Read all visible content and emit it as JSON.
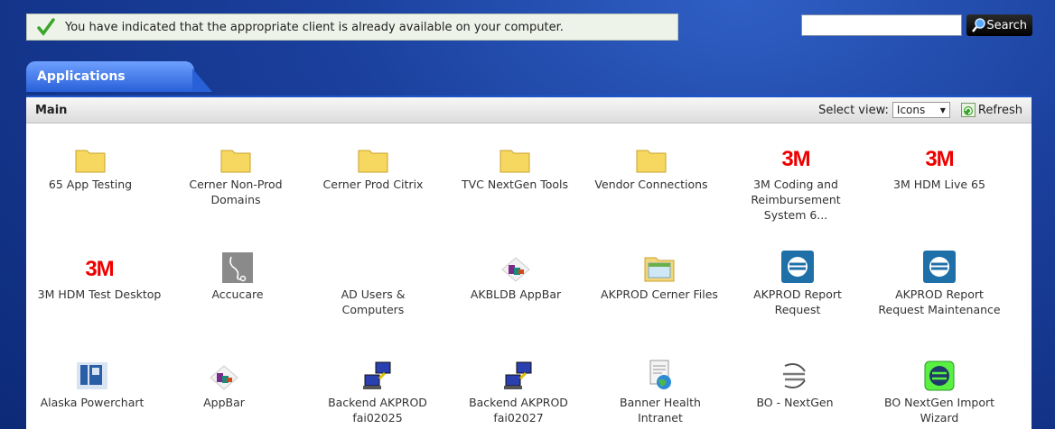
{
  "notice": {
    "text": "You have indicated that the appropriate client is already available on your computer."
  },
  "search": {
    "placeholder": "",
    "button_label": "Search"
  },
  "tabs": [
    {
      "label": "Applications"
    }
  ],
  "panel": {
    "title": "Main",
    "select_view_label": "Select view:",
    "select_view_value": "Icons",
    "refresh_label": "Refresh"
  },
  "apps": [
    {
      "label": "65 App Testing",
      "icon": "folder-icon"
    },
    {
      "label": "Cerner Non-Prod Domains",
      "icon": "folder-icon"
    },
    {
      "label": "Cerner Prod Citrix",
      "icon": "folder-icon"
    },
    {
      "label": "TVC NextGen Tools",
      "icon": "folder-icon"
    },
    {
      "label": "Vendor Connections",
      "icon": "folder-icon"
    },
    {
      "label": "3M Coding and Reimbursement System 6...",
      "icon": "3m-logo"
    },
    {
      "label": "3M HDM Live 65",
      "icon": "3m-logo"
    },
    {
      "label": "3M HDM Test Desktop",
      "icon": "3m-logo"
    },
    {
      "label": "Accucare",
      "icon": "stethoscope-icon"
    },
    {
      "label": "AD Users & Computers",
      "icon": "none"
    },
    {
      "label": "AKBLDB AppBar",
      "icon": "appbar-icon"
    },
    {
      "label": "AKPROD Cerner Files",
      "icon": "file-explorer-icon"
    },
    {
      "label": "AKPROD Report Request",
      "icon": "report-icon"
    },
    {
      "label": "AKPROD Report Request Maintenance",
      "icon": "report-icon"
    },
    {
      "label": "Alaska Powerchart",
      "icon": "powerchart-icon"
    },
    {
      "label": "AppBar",
      "icon": "appbar-icon"
    },
    {
      "label": "Backend AKPROD fai02025",
      "icon": "network-computers-icon"
    },
    {
      "label": "Backend AKPROD fai02027",
      "icon": "network-computers-icon"
    },
    {
      "label": "Banner Health Intranet",
      "icon": "intranet-globe-icon"
    },
    {
      "label": "BO - NextGen",
      "icon": "bo-nextgen-icon"
    },
    {
      "label": "BO NextGen Import Wizard",
      "icon": "import-wizard-icon"
    }
  ],
  "colors": {
    "tab_blue": "#2860d8",
    "logo_3m": "#e00000",
    "folder_yellow": "#f6d860"
  }
}
